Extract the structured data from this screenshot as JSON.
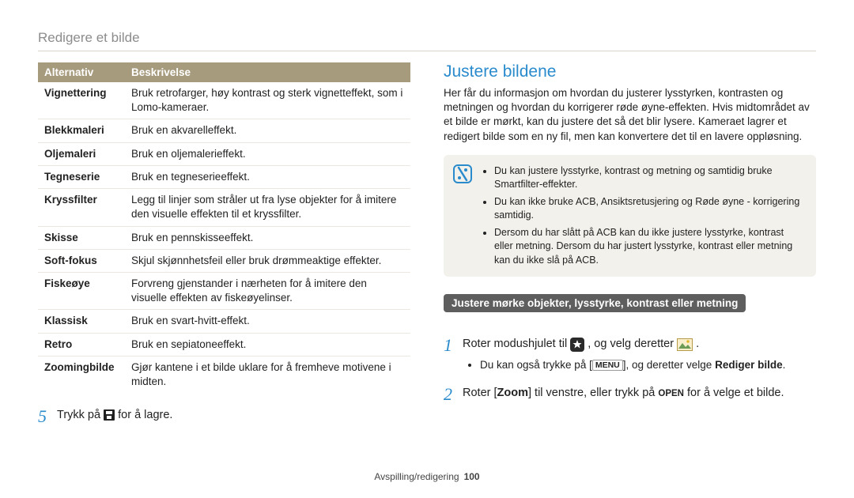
{
  "pageTitle": "Redigere et bilde",
  "table": {
    "headers": [
      "Alternativ",
      "Beskrivelse"
    ],
    "rows": [
      {
        "k": "Vignettering",
        "v": "Bruk retrofarger, høy kontrast og sterk vignetteffekt, som i Lomo-kameraer."
      },
      {
        "k": "Blekkmaleri",
        "v": "Bruk en akvarelleffekt."
      },
      {
        "k": "Oljemaleri",
        "v": "Bruk en oljemalerieffekt."
      },
      {
        "k": "Tegneserie",
        "v": "Bruk en tegneserieeffekt."
      },
      {
        "k": "Kryssfilter",
        "v": "Legg til linjer som stråler ut fra lyse objekter for å imitere den visuelle effekten til et kryssfilter."
      },
      {
        "k": "Skisse",
        "v": "Bruk en pennskisseeffekt."
      },
      {
        "k": "Soft-fokus",
        "v": "Skjul skjønnhetsfeil eller bruk drømmeaktige effekter."
      },
      {
        "k": "Fiskeøye",
        "v": "Forvreng gjenstander i nærheten for å imitere den visuelle effekten av fiskeøyelinser."
      },
      {
        "k": "Klassisk",
        "v": "Bruk en svart-hvitt-effekt."
      },
      {
        "k": "Retro",
        "v": "Bruk en sepiatoneeffekt."
      },
      {
        "k": "Zoomingbilde",
        "v": "Gjør kantene i et bilde uklare for å fremheve motivene i midten."
      }
    ]
  },
  "step5": {
    "n": "5",
    "a": "Trykk på ",
    "b": " for å lagre."
  },
  "right": {
    "heading": "Justere bildene",
    "intro": "Her får du informasjon om hvordan du justerer lysstyrken, kontrasten og metningen og hvordan du korrigerer røde øyne-effekten. Hvis midtområdet av et bilde er mørkt, kan du justere det så det blir lysere. Kameraet lagrer et redigert bilde som en ny fil, men kan konvertere det til en lavere oppløsning.",
    "notes": [
      "Du kan justere lysstyrke, kontrast og metning og samtidig bruke Smartfilter-effekter.",
      "Du kan ikke bruke ACB, Ansiktsretusjering og Røde øyne - korrigering samtidig.",
      "Dersom du har slått på ACB kan du ikke justere lysstyrke, kontrast eller metning. Dersom du har justert lysstyrke, kontrast eller metning kan du ikke slå på ACB."
    ],
    "subhead": "Justere mørke objekter, lysstyrke, kontrast eller metning",
    "step1": {
      "n": "1",
      "a": "Roter modushjulet til ",
      "b": ", og velg deretter ",
      "c": "."
    },
    "sub1": {
      "a": "Du kan også trykke på [",
      "menu": "MENU",
      "b": "], og deretter velge ",
      "bold": "Rediger bilde",
      "c": "."
    },
    "step2": {
      "n": "2",
      "a": "Roter [",
      "zoom": "Zoom",
      "b": "] til venstre, eller trykk på ",
      "open": "OPEN",
      "c": " for å velge et bilde."
    }
  },
  "footer": {
    "section": "Avspilling/redigering",
    "page": "100"
  }
}
